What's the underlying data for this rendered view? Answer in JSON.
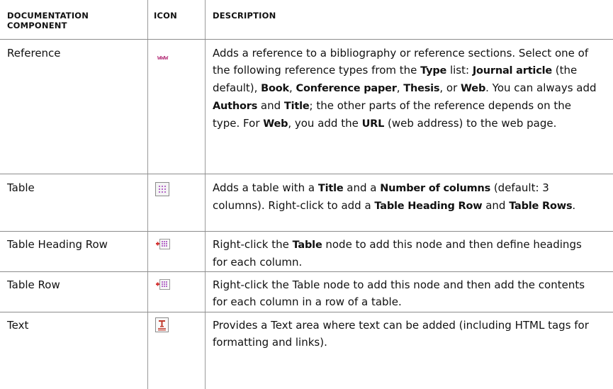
{
  "headers": {
    "component": "DOCUMENTATION COMPONENT",
    "icon": "ICON",
    "description": "DESCRIPTION"
  },
  "rows": [
    {
      "name": "Reference",
      "icon": "www-icon",
      "icon_text": "www",
      "description": [
        {
          "t": "Adds a reference to a bibliography or reference sections. Select one of the following reference types from the ",
          "b": false
        },
        {
          "t": "Type",
          "b": true
        },
        {
          "t": " list: ",
          "b": false
        },
        {
          "t": "Journal article",
          "b": true
        },
        {
          "t": " (the default), ",
          "b": false
        },
        {
          "t": "Book",
          "b": true
        },
        {
          "t": ", ",
          "b": false
        },
        {
          "t": "Conference paper",
          "b": true
        },
        {
          "t": ", ",
          "b": false
        },
        {
          "t": "Thesis",
          "b": true
        },
        {
          "t": ", or ",
          "b": false
        },
        {
          "t": "Web",
          "b": true
        },
        {
          "t": ". You can always add ",
          "b": false
        },
        {
          "t": "Authors",
          "b": true
        },
        {
          "t": " and ",
          "b": false
        },
        {
          "t": "Title",
          "b": true
        },
        {
          "t": "; the other parts of the reference depends on the type. For ",
          "b": false
        },
        {
          "t": "Web",
          "b": true
        },
        {
          "t": ", you add the ",
          "b": false
        },
        {
          "t": "URL",
          "b": true
        },
        {
          "t": " (web address) to the web page.",
          "b": false
        }
      ]
    },
    {
      "name": "Table",
      "icon": "table-icon",
      "description": [
        {
          "t": "Adds a table with a ",
          "b": false
        },
        {
          "t": "Title",
          "b": true
        },
        {
          "t": " and a ",
          "b": false
        },
        {
          "t": "Number of columns",
          "b": true
        },
        {
          "t": " (default: 3 columns). Right-click to add a ",
          "b": false
        },
        {
          "t": "Table Heading Row",
          "b": true
        },
        {
          "t": " and ",
          "b": false
        },
        {
          "t": "Table Rows",
          "b": true
        },
        {
          "t": ".",
          "b": false
        }
      ]
    },
    {
      "name": "Table Heading Row",
      "icon": "table-heading-row-icon",
      "description": [
        {
          "t": "Right-click the ",
          "b": false
        },
        {
          "t": "Table",
          "b": true
        },
        {
          "t": " node to add this node and then define headings for each column.",
          "b": false
        }
      ]
    },
    {
      "name": "Table Row",
      "icon": "table-row-icon",
      "description": [
        {
          "t": "Right-click the Table node to add this node and then add the contents for each column in a row of a table.",
          "b": false
        }
      ]
    },
    {
      "name": "Text",
      "icon": "text-icon",
      "description": [
        {
          "t": "Provides a Text area where text can be added (including HTML tags for formatting and links).",
          "b": false
        }
      ]
    }
  ],
  "colors": {
    "rule": "#8c8c8c",
    "www": "#b8387e",
    "text_icon_accent": "#c0392b"
  }
}
